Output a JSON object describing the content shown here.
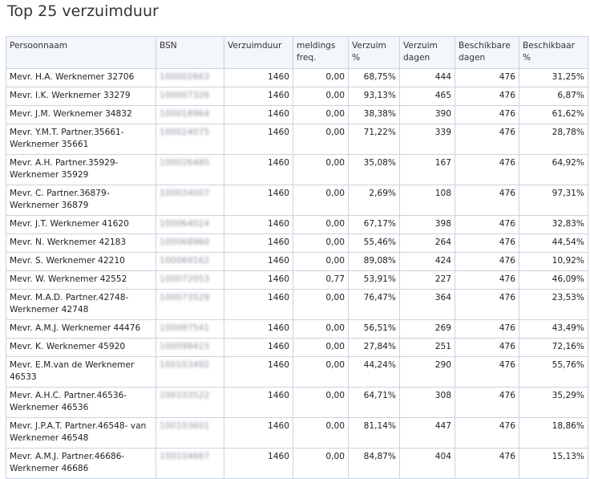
{
  "title": "Top 25 verzuimduur",
  "columns": [
    "Persoonnaam",
    "BSN",
    "Verzuimduur",
    "meldings freq.",
    "Verzuim %",
    "Verzuim dagen",
    "Beschikbare dagen",
    "Beschikbaar %"
  ],
  "rows": [
    {
      "name": "Mevr. H.A. Werknemer 32706",
      "bsn": "100002663",
      "duur": "1460",
      "freq": "0,00",
      "verzuim_pct": "68,75%",
      "verzuim_dagen": "444",
      "beschikbare_dagen": "476",
      "beschikbaar_pct": "31,25%"
    },
    {
      "name": "Mevr. I.K. Werknemer 33279",
      "bsn": "100007326",
      "duur": "1460",
      "freq": "0,00",
      "verzuim_pct": "93,13%",
      "verzuim_dagen": "465",
      "beschikbare_dagen": "476",
      "beschikbaar_pct": "6,87%"
    },
    {
      "name": "Mevr. J.M. Werknemer 34832",
      "bsn": "100018964",
      "duur": "1460",
      "freq": "0,00",
      "verzuim_pct": "38,38%",
      "verzuim_dagen": "390",
      "beschikbare_dagen": "476",
      "beschikbaar_pct": "61,62%"
    },
    {
      "name": "Mevr. Y.M.T. Partner.35661-Werknemer 35661",
      "bsn": "100024075",
      "duur": "1460",
      "freq": "0,00",
      "verzuim_pct": "71,22%",
      "verzuim_dagen": "339",
      "beschikbare_dagen": "476",
      "beschikbaar_pct": "28,78%"
    },
    {
      "name": "Mevr. A.H. Partner.35929-Werknemer 35929",
      "bsn": "100026485",
      "duur": "1460",
      "freq": "0,00",
      "verzuim_pct": "35,08%",
      "verzuim_dagen": "167",
      "beschikbare_dagen": "476",
      "beschikbaar_pct": "64,92%"
    },
    {
      "name": "Mevr. C. Partner.36879-Werknemer 36879",
      "bsn": "100034007",
      "duur": "1460",
      "freq": "0,00",
      "verzuim_pct": "2,69%",
      "verzuim_dagen": "108",
      "beschikbare_dagen": "476",
      "beschikbaar_pct": "97,31%"
    },
    {
      "name": "Mevr. J.T. Werknemer 41620",
      "bsn": "100064024",
      "duur": "1460",
      "freq": "0,00",
      "verzuim_pct": "67,17%",
      "verzuim_dagen": "398",
      "beschikbare_dagen": "476",
      "beschikbaar_pct": "32,83%"
    },
    {
      "name": "Mevr. N. Werknemer 42183",
      "bsn": "100068960",
      "duur": "1460",
      "freq": "0,00",
      "verzuim_pct": "55,46%",
      "verzuim_dagen": "264",
      "beschikbare_dagen": "476",
      "beschikbaar_pct": "44,54%"
    },
    {
      "name": "Mevr. S. Werknemer 42210",
      "bsn": "100069162",
      "duur": "1460",
      "freq": "0,00",
      "verzuim_pct": "89,08%",
      "verzuim_dagen": "424",
      "beschikbare_dagen": "476",
      "beschikbaar_pct": "10,92%"
    },
    {
      "name": "Mevr. W. Werknemer 42552",
      "bsn": "100072053",
      "duur": "1460",
      "freq": "0,77",
      "verzuim_pct": "53,91%",
      "verzuim_dagen": "227",
      "beschikbare_dagen": "476",
      "beschikbaar_pct": "46,09%"
    },
    {
      "name": "Mevr. M.A.D. Partner.42748-Werknemer 42748",
      "bsn": "100073529",
      "duur": "1460",
      "freq": "0,00",
      "verzuim_pct": "76,47%",
      "verzuim_dagen": "364",
      "beschikbare_dagen": "476",
      "beschikbaar_pct": "23,53%"
    },
    {
      "name": "Mevr. A.M.J. Werknemer 44476",
      "bsn": "100087541",
      "duur": "1460",
      "freq": "0,00",
      "verzuim_pct": "56,51%",
      "verzuim_dagen": "269",
      "beschikbare_dagen": "476",
      "beschikbaar_pct": "43,49%"
    },
    {
      "name": "Mevr. K. Werknemer 45920",
      "bsn": "100098415",
      "duur": "1460",
      "freq": "0,00",
      "verzuim_pct": "27,84%",
      "verzuim_dagen": "251",
      "beschikbare_dagen": "476",
      "beschikbaar_pct": "72,16%"
    },
    {
      "name": "Mevr. E.M.van de Werknemer 46533",
      "bsn": "100103492",
      "duur": "1460",
      "freq": "0,00",
      "verzuim_pct": "44,24%",
      "verzuim_dagen": "290",
      "beschikbare_dagen": "476",
      "beschikbaar_pct": "55,76%"
    },
    {
      "name": "Mevr. A.H.C. Partner.46536-Werknemer 46536",
      "bsn": "100103522",
      "duur": "1460",
      "freq": "0,00",
      "verzuim_pct": "64,71%",
      "verzuim_dagen": "308",
      "beschikbare_dagen": "476",
      "beschikbaar_pct": "35,29%"
    },
    {
      "name": "Mevr. J.P.A.T. Partner.46548- van Werknemer 46548",
      "bsn": "100103601",
      "duur": "1460",
      "freq": "0,00",
      "verzuim_pct": "81,14%",
      "verzuim_dagen": "447",
      "beschikbare_dagen": "476",
      "beschikbaar_pct": "18,86%"
    },
    {
      "name": "Mevr. A.M.J. Partner.46686-Werknemer 46686",
      "bsn": "100104667",
      "duur": "1460",
      "freq": "0,00",
      "verzuim_pct": "84,87%",
      "verzuim_dagen": "404",
      "beschikbare_dagen": "476",
      "beschikbaar_pct": "15,13%"
    }
  ]
}
